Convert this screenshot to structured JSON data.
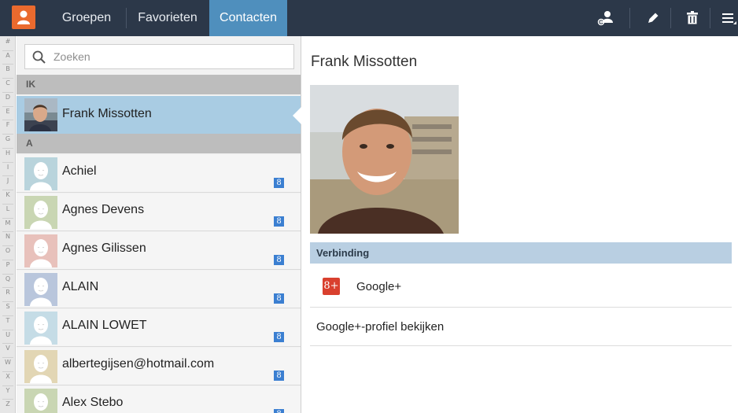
{
  "tabs": [
    {
      "label": "Groepen"
    },
    {
      "label": "Favorieten"
    },
    {
      "label": "Contacten"
    }
  ],
  "actions": [
    "add-contact-icon",
    "edit-icon",
    "delete-icon",
    "menu-icon"
  ],
  "alphabet": [
    "#",
    "A",
    "B",
    "C",
    "D",
    "E",
    "F",
    "G",
    "H",
    "I",
    "J",
    "K",
    "L",
    "M",
    "N",
    "O",
    "P",
    "Q",
    "R",
    "S",
    "T",
    "U",
    "V",
    "W",
    "X",
    "Y",
    "Z"
  ],
  "search": {
    "placeholder": "Zoeken",
    "value": ""
  },
  "sections": {
    "me": "IK",
    "a": "A"
  },
  "me": {
    "name": "Frank Missotten"
  },
  "contacts": [
    {
      "name": "Achiel",
      "avatar_color": "#b9d4dc",
      "badge": "8"
    },
    {
      "name": "Agnes Devens",
      "avatar_color": "#c9d6b3",
      "badge": "8"
    },
    {
      "name": "Agnes Gilissen",
      "avatar_color": "#e8c1bb",
      "badge": "8"
    },
    {
      "name": "ALAIN",
      "avatar_color": "#b9c6dc",
      "badge": "8"
    },
    {
      "name": "ALAIN LOWET",
      "avatar_color": "#c5dce6",
      "badge": "8"
    },
    {
      "name": "albertegijsen@hotmail.com",
      "avatar_color": "#e2d6b4",
      "badge": "8"
    },
    {
      "name": "Alex Stebo",
      "avatar_color": "#c9d6b3",
      "badge": "8"
    }
  ],
  "detail": {
    "name": "Frank Missotten",
    "connection_header": "Verbinding",
    "gplus_icon": "8+",
    "gplus_label": "Google+",
    "profile_link": "Google+-profiel bekijken"
  },
  "colors": {
    "topbar": "#2c3849",
    "active_tab": "#4f8fbd",
    "selected_row": "#a9cce3",
    "app_icon": "#ea6a2e",
    "gplus_red": "#d9402e",
    "badge_blue": "#3b7fd1"
  }
}
